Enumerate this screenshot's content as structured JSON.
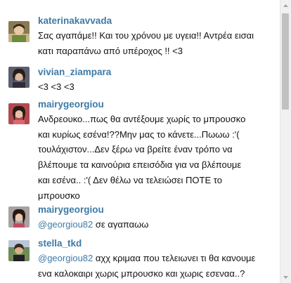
{
  "comments": [
    {
      "username": "katerinakavvada",
      "avatar": "avatar-katerinakavvada",
      "lines": [
        "Σας αγαπάμε!! Και του χρόνου με υγεια!! Αντρέα εισαι",
        "κατι παραπάνω από υπέροχος !! <3"
      ]
    },
    {
      "username": "vivian_ziampara",
      "avatar": "avatar-vivian_ziampara",
      "lines": [
        "<3 <3 <3"
      ]
    },
    {
      "username": "mairygeorgiou",
      "avatar": "avatar-mairygeorgiou",
      "lines": [
        "Ανδρεουκο...πως θα αντέξουμε χωρίς το μπρουσκο",
        "και κυρίως εσένα!??Μην μας το κάνετε...Πωωω :'(",
        "τουλάχιστον...Δεν ξέρω να βρείτε έναν τρόπο να",
        "βλέπουμε τα καινούρια επεισόδια για να βλέπουμε",
        "και εσένα.. :'( Δεν θέλω να τελειώσει ΠΟΤΕ το",
        "μπρουσκο"
      ]
    },
    {
      "username": "mairygeorgiou",
      "avatar": "avatar-mairygeorgiou",
      "mention": "@georgiou82",
      "lines": [
        " σε αγαπαωω"
      ]
    },
    {
      "username": "stella_tkd",
      "avatar": "avatar-stella_tkd",
      "mention": "@georgiou82",
      "lines": [
        " αχχ κριμαα που τελειωνει τι θα κανουμε",
        "ενα καλοκαιρι χωρις μπρουσκο και χωρις εσεναα..?"
      ]
    }
  ],
  "colors": {
    "username": "#3e7aa6",
    "text": "#111111",
    "scrollbar_track": "#f1f1f1",
    "scrollbar_thumb": "#c1c1c1"
  },
  "scrollbar": {
    "up_icon": "triangle-up-icon",
    "down_icon": "triangle-down-icon"
  }
}
